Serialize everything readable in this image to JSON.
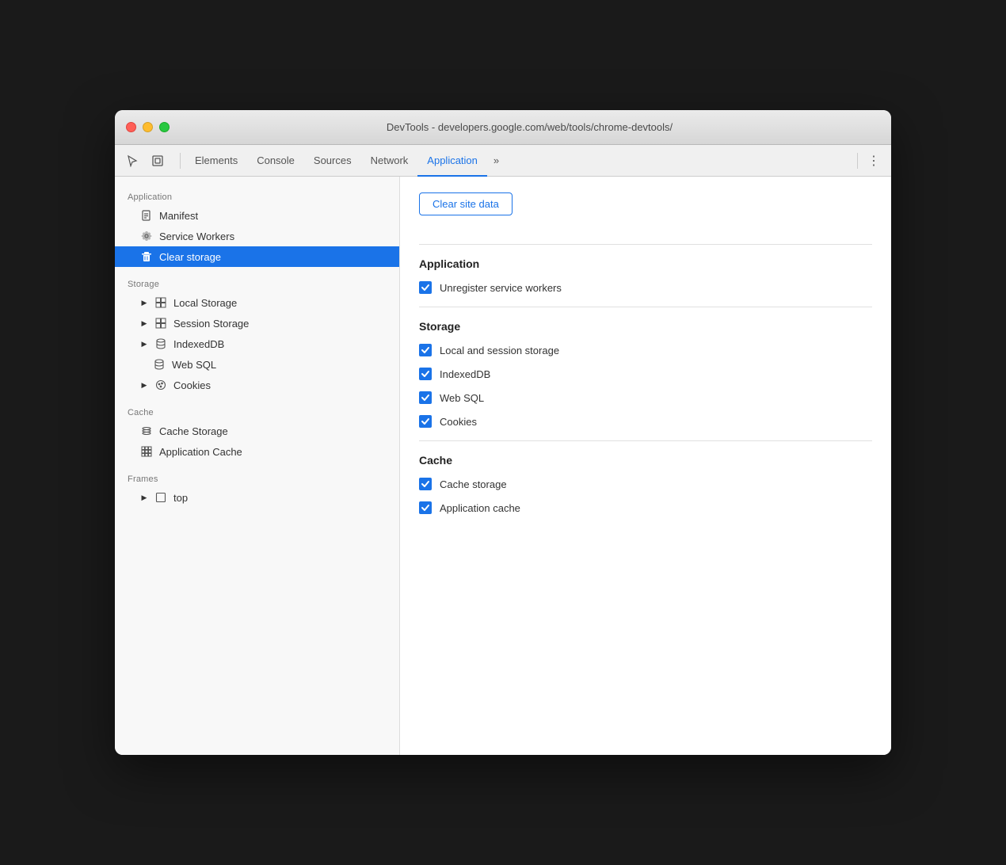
{
  "window": {
    "title": "DevTools - developers.google.com/web/tools/chrome-devtools/"
  },
  "toolbar": {
    "tabs": [
      {
        "id": "elements",
        "label": "Elements",
        "active": false
      },
      {
        "id": "console",
        "label": "Console",
        "active": false
      },
      {
        "id": "sources",
        "label": "Sources",
        "active": false
      },
      {
        "id": "network",
        "label": "Network",
        "active": false
      },
      {
        "id": "application",
        "label": "Application",
        "active": true
      }
    ],
    "more_label": "»",
    "menu_dots": "⋮"
  },
  "sidebar": {
    "sections": [
      {
        "id": "application",
        "label": "Application",
        "items": [
          {
            "id": "manifest",
            "label": "Manifest",
            "icon": "file",
            "indent": 1,
            "active": false
          },
          {
            "id": "service-workers",
            "label": "Service Workers",
            "icon": "gear",
            "indent": 1,
            "active": false
          },
          {
            "id": "clear-storage",
            "label": "Clear storage",
            "icon": "trash",
            "indent": 1,
            "active": true
          }
        ]
      },
      {
        "id": "storage",
        "label": "Storage",
        "items": [
          {
            "id": "local-storage",
            "label": "Local Storage",
            "icon": "grid",
            "indent": 1,
            "arrow": true,
            "active": false
          },
          {
            "id": "session-storage",
            "label": "Session Storage",
            "icon": "grid",
            "indent": 1,
            "arrow": true,
            "active": false
          },
          {
            "id": "indexeddb",
            "label": "IndexedDB",
            "icon": "db",
            "indent": 1,
            "arrow": true,
            "active": false
          },
          {
            "id": "web-sql",
            "label": "Web SQL",
            "icon": "db",
            "indent": 1,
            "arrow": false,
            "active": false
          },
          {
            "id": "cookies",
            "label": "Cookies",
            "icon": "cookie",
            "indent": 1,
            "arrow": true,
            "active": false
          }
        ]
      },
      {
        "id": "cache",
        "label": "Cache",
        "items": [
          {
            "id": "cache-storage",
            "label": "Cache Storage",
            "icon": "layers",
            "indent": 1,
            "active": false
          },
          {
            "id": "app-cache",
            "label": "Application Cache",
            "icon": "appgrid",
            "indent": 1,
            "active": false
          }
        ]
      },
      {
        "id": "frames",
        "label": "Frames",
        "items": [
          {
            "id": "top",
            "label": "top",
            "icon": "frame",
            "indent": 1,
            "arrow": true,
            "active": false
          }
        ]
      }
    ]
  },
  "panel": {
    "clear_button_label": "Clear site data",
    "sections": [
      {
        "id": "application",
        "title": "Application",
        "checkboxes": [
          {
            "id": "unregister-sw",
            "label": "Unregister service workers",
            "checked": true
          }
        ]
      },
      {
        "id": "storage",
        "title": "Storage",
        "checkboxes": [
          {
            "id": "local-session",
            "label": "Local and session storage",
            "checked": true
          },
          {
            "id": "indexeddb",
            "label": "IndexedDB",
            "checked": true
          },
          {
            "id": "web-sql",
            "label": "Web SQL",
            "checked": true
          },
          {
            "id": "cookies",
            "label": "Cookies",
            "checked": true
          }
        ]
      },
      {
        "id": "cache",
        "title": "Cache",
        "checkboxes": [
          {
            "id": "cache-storage",
            "label": "Cache storage",
            "checked": true
          },
          {
            "id": "app-cache",
            "label": "Application cache",
            "checked": true
          }
        ]
      }
    ]
  }
}
